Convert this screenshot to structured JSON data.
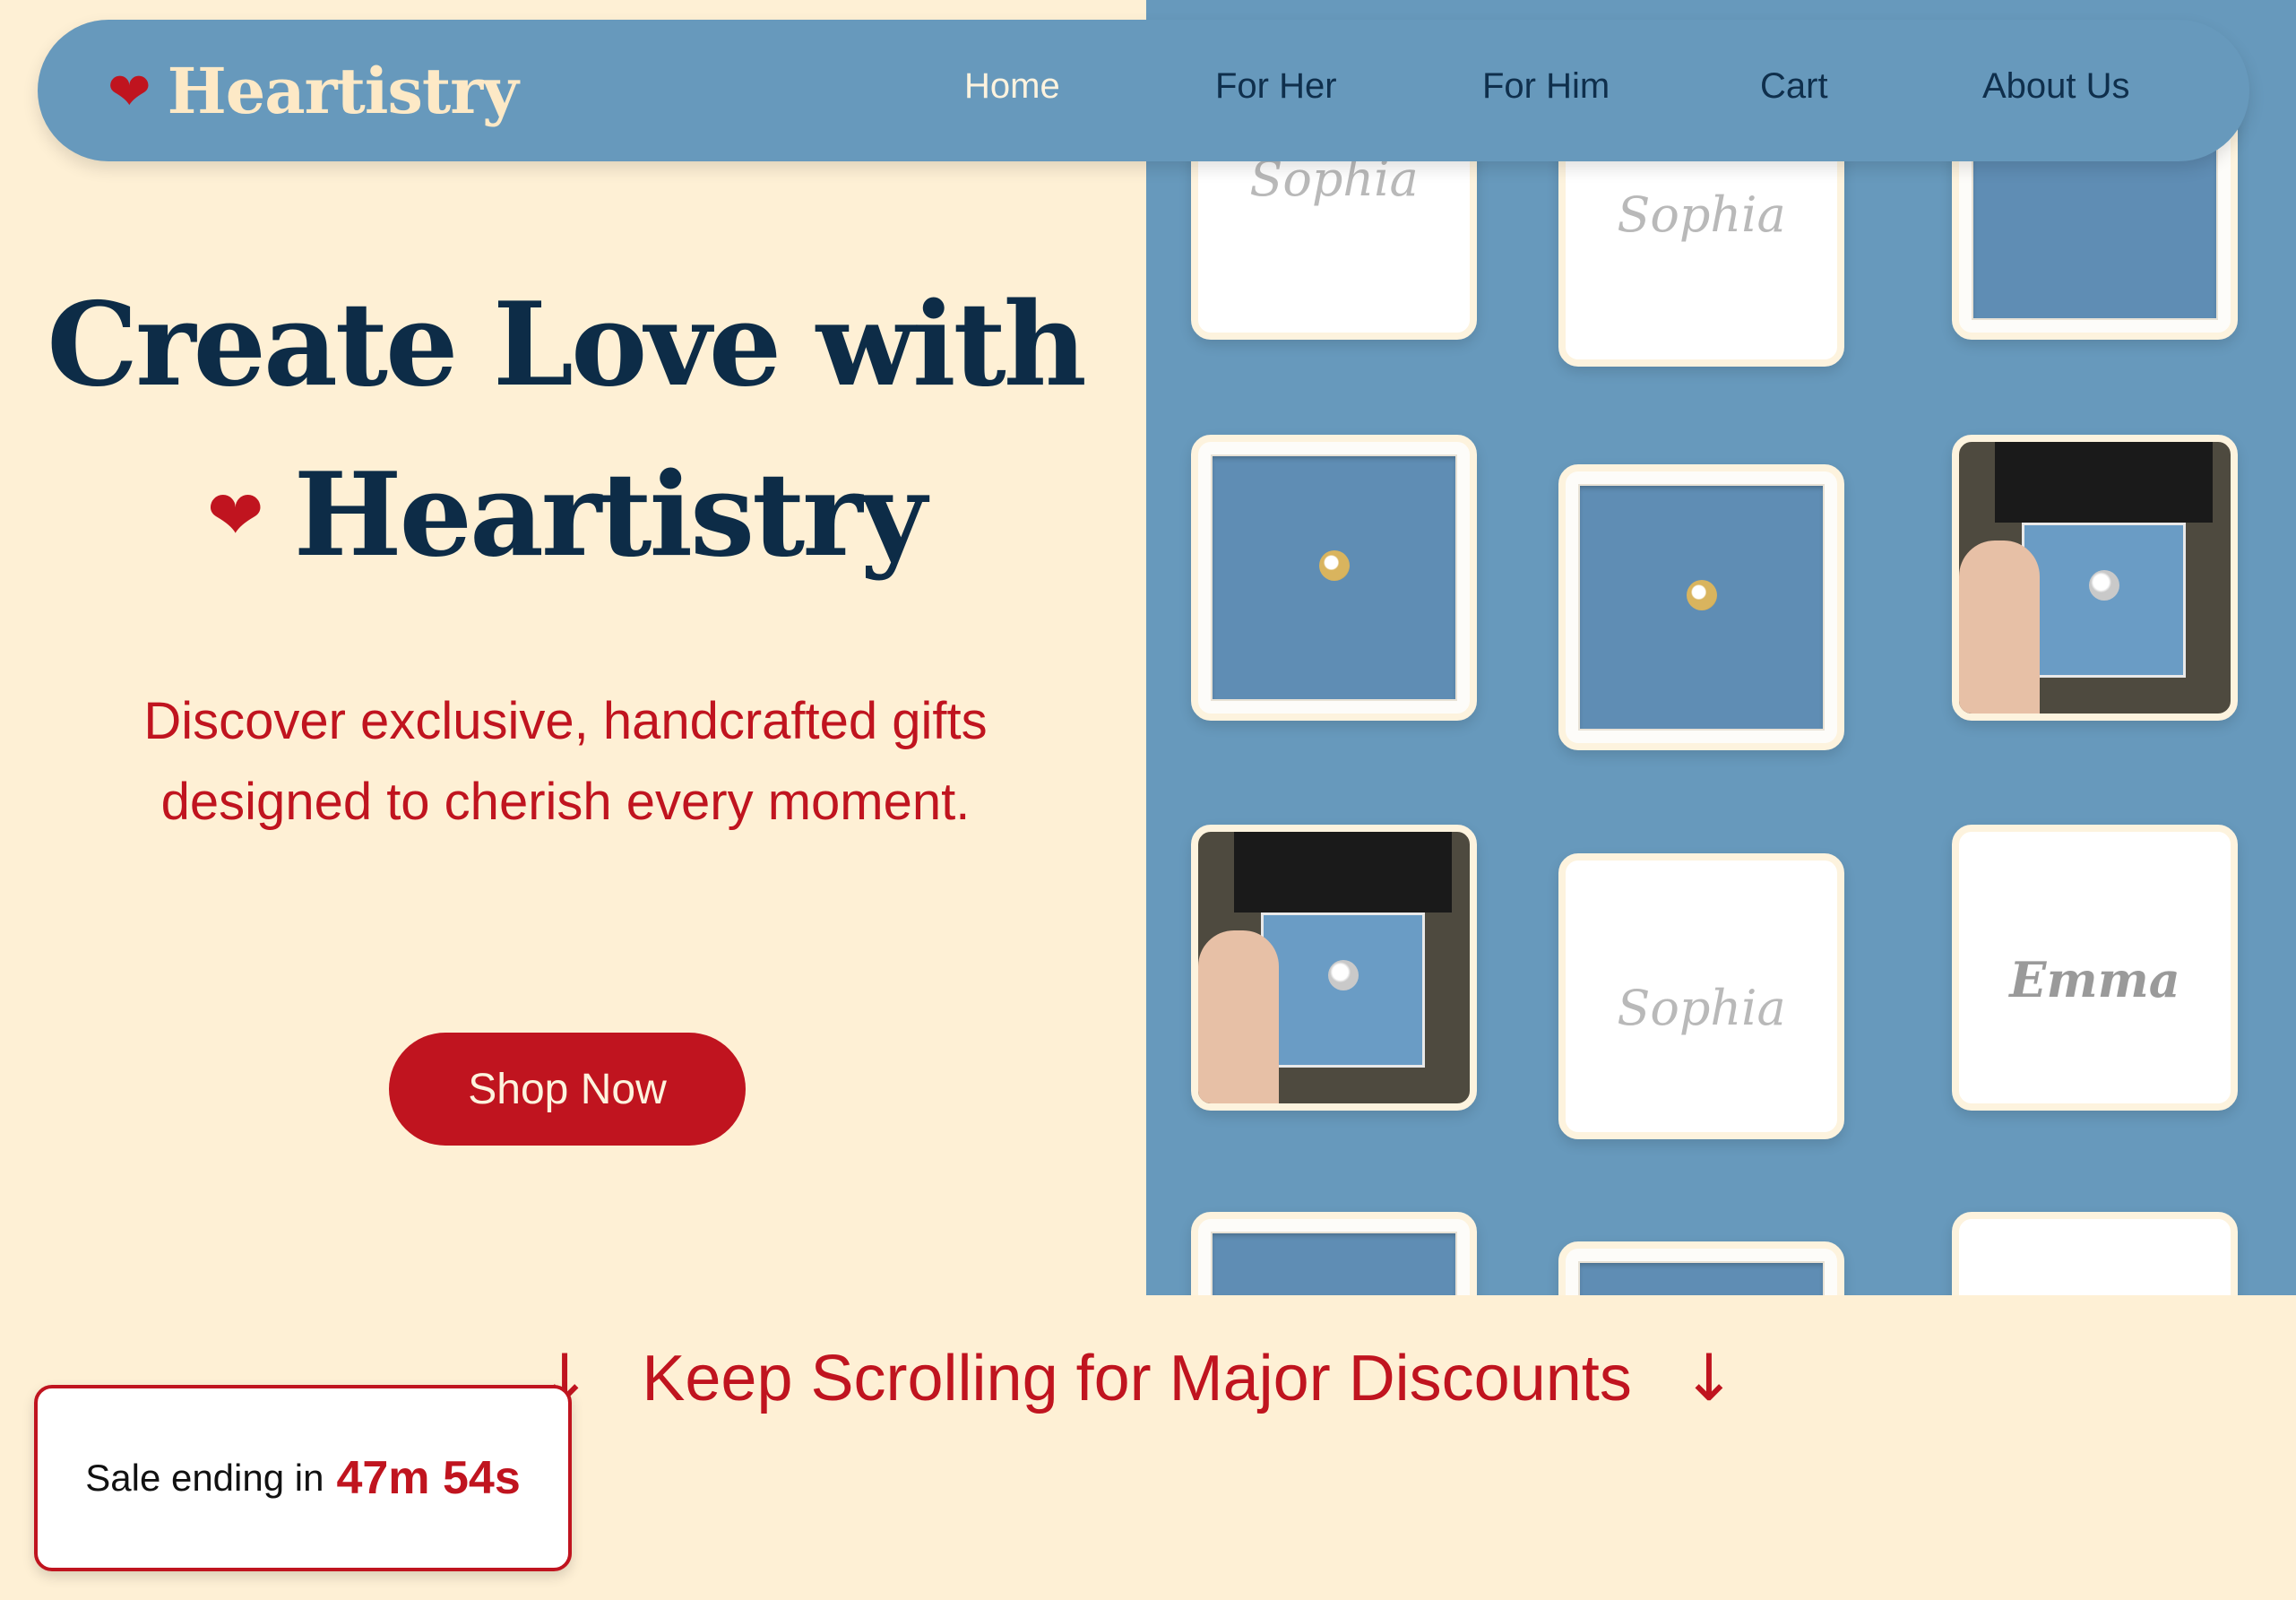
{
  "nav": {
    "brand": "Heartistry",
    "links": [
      "Home",
      "For Her",
      "For Him",
      "Cart",
      "About Us"
    ],
    "active": "Home"
  },
  "hero": {
    "headline_line1": "Create Love with",
    "headline_line2": "Heartistry",
    "tagline_line1": "Discover exclusive, handcrafted gifts",
    "tagline_line2": "designed to cherish every moment.",
    "cta": "Shop Now"
  },
  "gallery": {
    "name_text_1": "Sophia",
    "name_text_2": "Emma"
  },
  "promo": {
    "scroll_text": "Keep Scrolling for Major Discounts",
    "sale_label": "Sale ending in",
    "sale_time": "47m 54s"
  },
  "colors": {
    "cream": "#fef0d5",
    "blue": "#6799bc",
    "navy": "#0d2c47",
    "red": "#c0141f"
  }
}
